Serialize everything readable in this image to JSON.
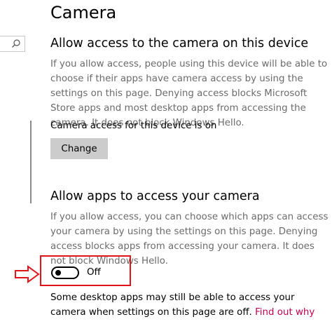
{
  "page_title": "Camera",
  "device_section": {
    "heading": "Allow access to the camera on this device",
    "description": "If you allow access, people using this device will be able to choose if their apps have camera access by using the settings on this page. Denying access blocks Microsoft Store apps and most desktop apps from accessing the camera. It does not block Windows Hello.",
    "status": "Camera access for this device is on",
    "change_button_label": "Change"
  },
  "apps_section": {
    "heading": "Allow apps to access your camera",
    "description": "If you allow access, you can choose which apps can access your camera by using the settings on this page. Denying access blocks apps from accessing your camera. It does not block Windows Hello.",
    "toggle_state": "Off",
    "footer_text": "Some desktop apps may still be able to access your camera when settings on this page are off.",
    "footer_link": "Find out why"
  },
  "colors": {
    "accent_link": "#c30052",
    "annotation": "#e0151b",
    "button_bg": "#cccccc",
    "description_text": "#6b6b6b"
  },
  "icons": {
    "search": "search-icon",
    "annotation_arrow": "right-arrow-icon"
  }
}
